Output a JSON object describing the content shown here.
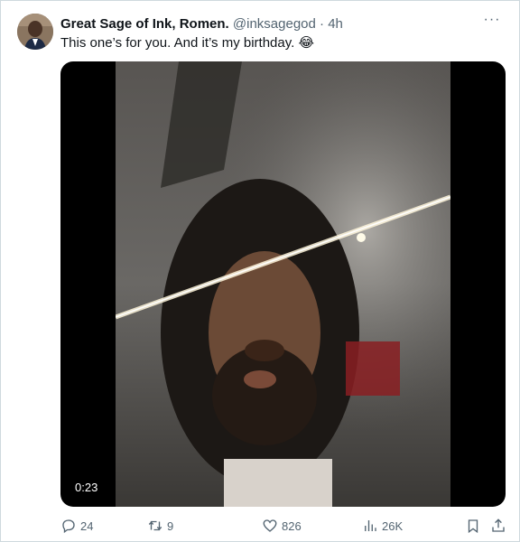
{
  "tweet": {
    "author": {
      "display_name": "Great Sage of Ink, Romen.",
      "handle": "@inksagegod",
      "separator": "·",
      "time": "4h"
    },
    "text": "This one’s for you. And it’s my birthday. 😂",
    "media": {
      "type": "video",
      "duration": "0:23"
    },
    "actions": {
      "replies": "24",
      "reposts": "9",
      "likes": "826",
      "views": "26K"
    },
    "more_menu": "···"
  },
  "icons": {
    "avatar": "avatar",
    "more": "more-dots-icon",
    "reply": "reply-icon",
    "repost": "repost-icon",
    "like": "heart-icon",
    "views": "views-bar-icon",
    "bookmark": "bookmark-icon",
    "share": "share-icon"
  },
  "colors": {
    "secondary_text": "#536471",
    "primary_text": "#0f1419",
    "border": "#cfd9de"
  }
}
